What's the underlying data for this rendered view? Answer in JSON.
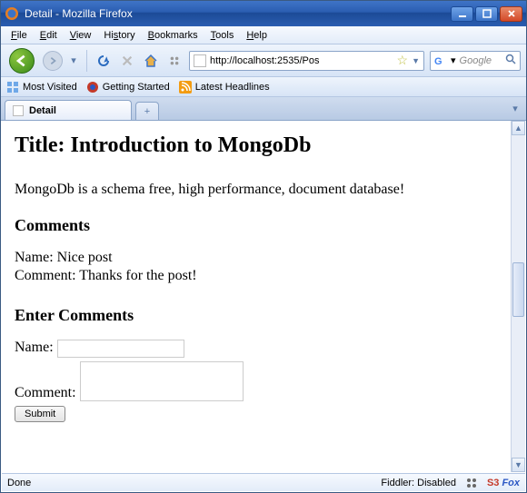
{
  "window": {
    "title": "Detail - Mozilla Firefox"
  },
  "menu": {
    "file": "File",
    "edit": "Edit",
    "view": "View",
    "history": "History",
    "bookmarks": "Bookmarks",
    "tools": "Tools",
    "help": "Help"
  },
  "navbar": {
    "url": "http://localhost:2535/Pos",
    "search_placeholder": "Google"
  },
  "bookmarks_bar": {
    "items": [
      {
        "label": "Most Visited"
      },
      {
        "label": "Getting Started"
      },
      {
        "label": "Latest Headlines"
      }
    ]
  },
  "tabs": {
    "active": {
      "label": "Detail"
    }
  },
  "content": {
    "title": "Title: Introduction to MongoDb",
    "body": "MongoDb is a schema free, high performance, document database!",
    "comments_heading": "Comments",
    "comments": [
      {
        "name_label": "Name:",
        "name": "Nice post",
        "comment_label": "Comment:",
        "comment": "Thanks for the post!"
      }
    ],
    "form_heading": "Enter Comments",
    "form": {
      "name_label": "Name:",
      "name_value": "",
      "comment_label": "Comment:",
      "comment_value": "",
      "submit_label": "Submit"
    }
  },
  "statusbar": {
    "status": "Done",
    "fiddler": "Fiddler: Disabled",
    "s3fox_s3": "S3",
    "s3fox_fox": "Fox"
  }
}
